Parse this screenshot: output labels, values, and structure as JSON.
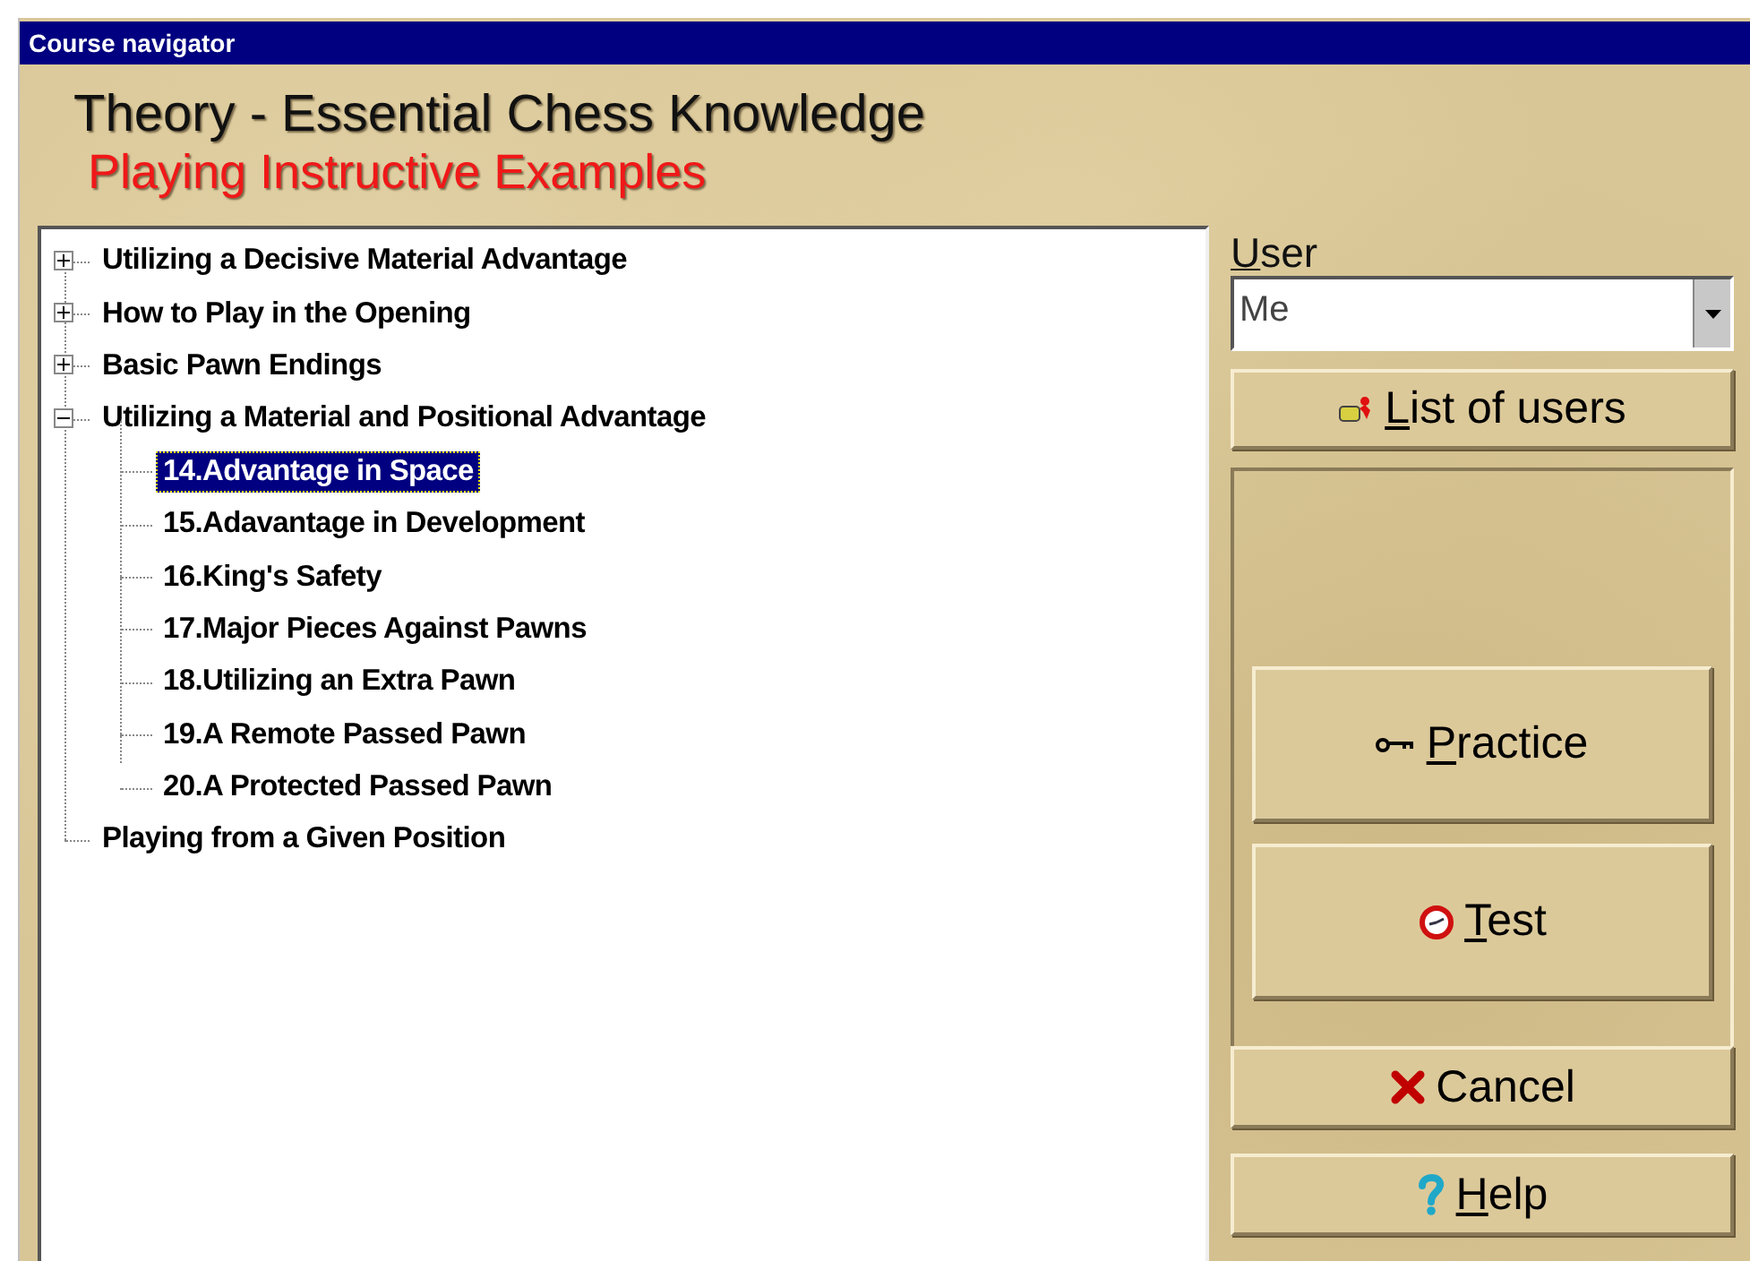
{
  "window": {
    "title": "Course navigator"
  },
  "heading": "Theory - Essential Chess Knowledge",
  "subheading": "Playing Instructive Examples",
  "tree": [
    {
      "label": "Utilizing a Decisive Material Advantage",
      "expanded": false,
      "selected": false
    },
    {
      "label": "How to Play in the Opening",
      "expanded": false,
      "selected": false
    },
    {
      "label": "Basic Pawn Endings",
      "expanded": false,
      "selected": false
    },
    {
      "label": "Utilizing a Material and Positional Advantage",
      "expanded": true,
      "selected": false,
      "children": [
        {
          "label": "14.Advantage in Space",
          "selected": true
        },
        {
          "label": "15.Adavantage in Development",
          "selected": false
        },
        {
          "label": "16.King's Safety",
          "selected": false
        },
        {
          "label": "17.Major Pieces Against Pawns",
          "selected": false
        },
        {
          "label": "18.Utilizing an Extra Pawn",
          "selected": false
        },
        {
          "label": "19.A Remote Passed Pawn",
          "selected": false
        },
        {
          "label": "20.A Protected Passed Pawn",
          "selected": false
        }
      ]
    },
    {
      "label": "Playing from a Given Position",
      "selected": false
    }
  ],
  "user": {
    "label": "User",
    "underline_first": true,
    "value": "Me"
  },
  "list_users_button": {
    "label": "List of users",
    "underline_first": true
  },
  "practice_button": {
    "label": "Practice",
    "underline_first": true
  },
  "test_button": {
    "label": "Test",
    "underline_first": true
  },
  "cancel_button": {
    "label": "Cancel",
    "underline_first": false
  },
  "help_button": {
    "label": "Help",
    "underline_first": true
  }
}
